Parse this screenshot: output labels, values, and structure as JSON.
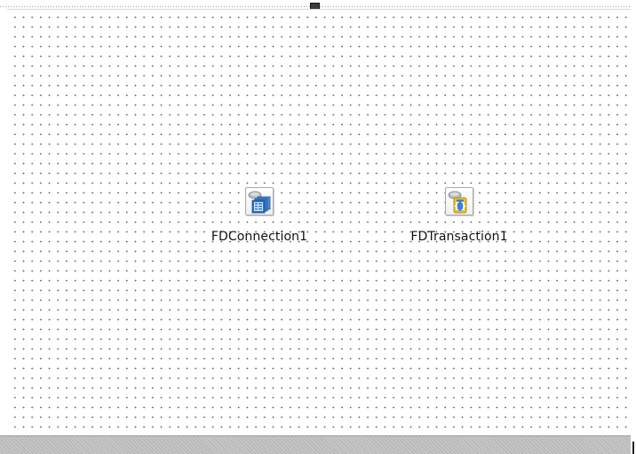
{
  "form": {
    "components": [
      {
        "caption": "FDConnection1",
        "icon": "fdconnection-icon"
      },
      {
        "caption": "FDTransaction1",
        "icon": "fdtransaction-icon"
      }
    ]
  },
  "colors": {
    "surface": "#ffffff",
    "grid_dot": "#6b6b6b",
    "icon_blue": "#2f74c8",
    "icon_yellow": "#f2c21b"
  }
}
